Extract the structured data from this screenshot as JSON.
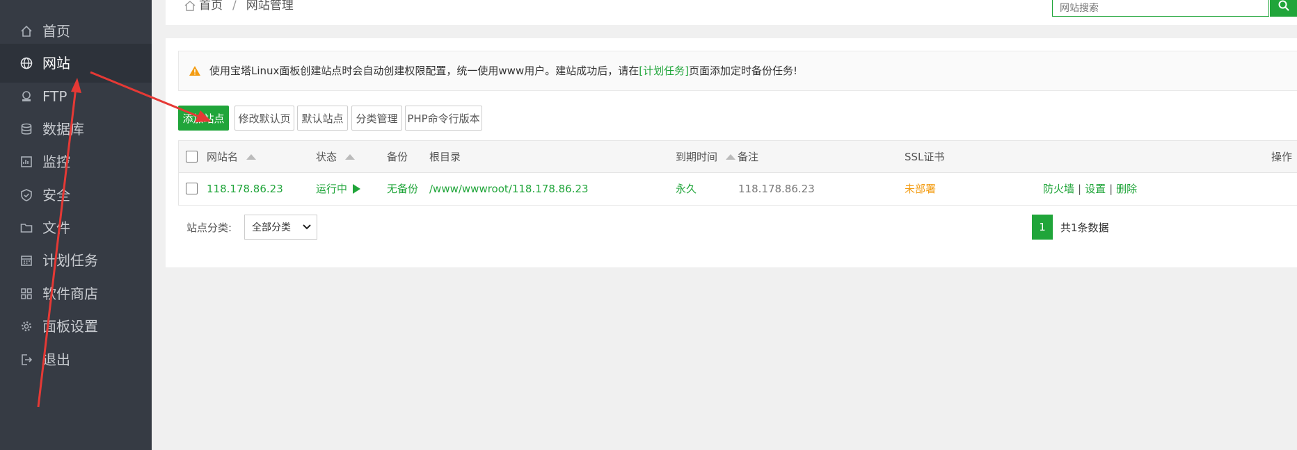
{
  "sidebar": {
    "items": [
      {
        "label": "首页",
        "icon": "home-icon"
      },
      {
        "label": "网站",
        "icon": "globe-icon",
        "active": true
      },
      {
        "label": "FTP",
        "icon": "ftp-icon"
      },
      {
        "label": "数据库",
        "icon": "database-icon"
      },
      {
        "label": "监控",
        "icon": "monitor-icon"
      },
      {
        "label": "安全",
        "icon": "shield-icon"
      },
      {
        "label": "文件",
        "icon": "folder-icon"
      },
      {
        "label": "计划任务",
        "icon": "calendar-icon"
      },
      {
        "label": "软件商店",
        "icon": "apps-icon"
      },
      {
        "label": "面板设置",
        "icon": "gear-icon"
      },
      {
        "label": "退出",
        "icon": "logout-icon"
      }
    ]
  },
  "header": {
    "breadcrumb_home": "首页",
    "breadcrumb_sep": "/",
    "breadcrumb_current": "网站管理",
    "search_placeholder": "网站搜索"
  },
  "alert": {
    "text_before": "使用宝塔Linux面板创建站点时会自动创建权限配置，统一使用www用户。建站成功后，请在",
    "link": "[计划任务]",
    "text_after": "页面添加定时备份任务!"
  },
  "buttons": {
    "add_site": "添加站点",
    "modify_default_page": "修改默认页",
    "default_site": "默认站点",
    "category_manage": "分类管理",
    "php_cli_version": "PHP命令行版本"
  },
  "table": {
    "columns": {
      "site_name": "网站名",
      "status": "状态",
      "backup": "备份",
      "root_dir": "根目录",
      "expiry": "到期时间",
      "remark": "备注",
      "ssl": "SSL证书",
      "actions": "操作"
    },
    "rows": [
      {
        "site_name": "118.178.86.23",
        "status": "运行中",
        "backup": "无备份",
        "root_dir": "/www/wwwroot/118.178.86.23",
        "expiry": "永久",
        "remark": "118.178.86.23",
        "ssl": "未部署",
        "action_firewall": "防火墙",
        "action_settings": "设置",
        "action_delete": "删除"
      }
    ]
  },
  "footer": {
    "category_label": "站点分类:",
    "category_selected": "全部分类",
    "page_current": "1",
    "total_text": "共1条数据"
  },
  "colors": {
    "accent": "#20a53a",
    "sidebar_bg": "#363b44",
    "warning": "#f39c12",
    "annotation": "#e53935"
  }
}
